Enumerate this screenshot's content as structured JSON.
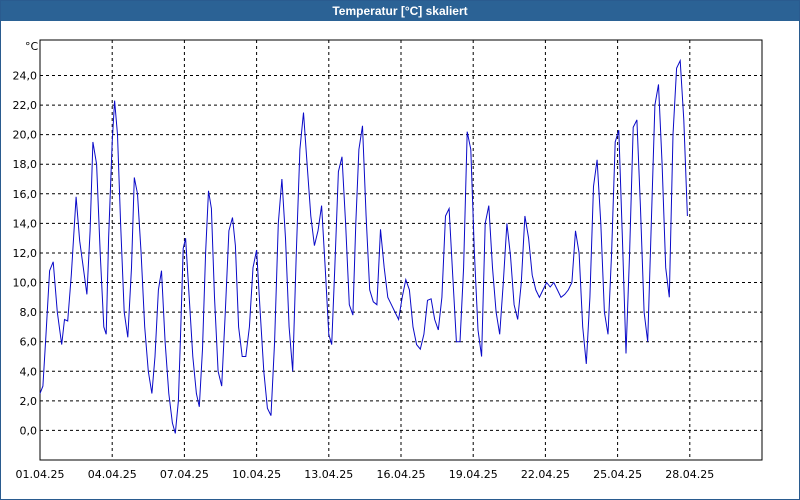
{
  "window": {
    "title": "Temperatur [°C] skaliert"
  },
  "colors": {
    "titlebar": "#2b6295",
    "series": "#0a0ac8",
    "grid": "#000000"
  },
  "chart_data": {
    "type": "line",
    "title": "Temperatur [°C] skaliert",
    "ylabel": "°C",
    "xlabel": "",
    "grid": true,
    "ylim": [
      -2.0,
      26.4
    ],
    "xlim": [
      "01.04.25",
      "31.04.25"
    ],
    "y_ticks": [
      "0,0",
      "2,0",
      "4,0",
      "6,0",
      "8,0",
      "10,0",
      "12,0",
      "14,0",
      "16,0",
      "18,0",
      "20,0",
      "22,0",
      "24,0"
    ],
    "x_ticks": [
      "01.04.25",
      "04.04.25",
      "07.04.25",
      "10.04.25",
      "13.04.25",
      "16.04.25",
      "19.04.25",
      "22.04.25",
      "25.04.25",
      "28.04.25"
    ],
    "x_tick_days": [
      1,
      4,
      7,
      10,
      13,
      16,
      19,
      22,
      25,
      28
    ],
    "series": [
      {
        "name": "",
        "x_days": [
          1.0,
          1.12,
          1.25,
          1.4,
          1.55,
          1.72,
          1.9,
          2.02,
          2.15,
          2.3,
          2.5,
          2.65,
          2.8,
          2.95,
          3.08,
          3.2,
          3.35,
          3.5,
          3.65,
          3.75,
          3.85,
          4.0,
          4.1,
          4.22,
          4.35,
          4.5,
          4.65,
          4.8,
          4.92,
          5.05,
          5.2,
          5.35,
          5.5,
          5.65,
          5.78,
          5.92,
          6.05,
          6.2,
          6.35,
          6.5,
          6.62,
          6.75,
          6.85,
          6.95,
          7.05,
          7.2,
          7.35,
          7.5,
          7.62,
          7.75,
          7.88,
          8.0,
          8.12,
          8.25,
          8.4,
          8.55,
          8.7,
          8.85,
          9.0,
          9.12,
          9.25,
          9.4,
          9.55,
          9.7,
          9.85,
          10.0,
          10.15,
          10.3,
          10.45,
          10.6,
          10.75,
          10.9,
          11.05,
          11.2,
          11.35,
          11.5,
          11.65,
          11.8,
          11.95,
          12.1,
          12.25,
          12.4,
          12.55,
          12.7,
          12.85,
          13.0,
          13.12,
          13.25,
          13.4,
          13.55,
          13.7,
          13.85,
          14.0,
          14.12,
          14.25,
          14.4,
          14.55,
          14.7,
          14.85,
          15.0,
          15.15,
          15.3,
          15.45,
          15.6,
          15.75,
          15.9,
          16.05,
          16.2,
          16.35,
          16.5,
          16.65,
          16.8,
          16.95,
          17.1,
          17.25,
          17.4,
          17.55,
          17.7,
          17.85,
          18.0,
          18.15,
          18.3,
          18.45,
          18.6,
          18.75,
          18.9,
          19.05,
          19.2,
          19.35,
          19.5,
          19.65,
          19.8,
          19.95,
          20.1,
          20.25,
          20.4,
          20.55,
          20.7,
          20.85,
          21.0,
          21.15,
          21.3,
          21.45,
          21.6,
          21.75,
          21.9,
          22.05,
          22.2,
          22.35,
          22.5,
          22.65,
          22.8,
          22.95,
          23.1,
          23.25,
          23.4,
          23.55,
          23.7,
          23.85,
          24.0,
          24.15,
          24.3,
          24.45,
          24.6,
          24.75,
          24.9,
          25.05,
          25.2,
          25.35,
          25.5,
          25.65,
          25.8,
          25.95,
          26.1,
          26.25,
          26.4,
          26.55,
          26.7,
          26.85,
          27.0,
          27.15,
          27.3,
          27.45,
          27.6,
          27.75,
          27.9,
          28.05,
          28.2,
          28.35,
          28.5,
          28.65,
          28.8,
          28.95,
          29.1,
          29.25,
          29.4,
          29.55,
          29.7,
          29.85,
          30.0,
          30.15,
          30.3,
          30.45,
          30.6,
          30.75,
          30.9
        ],
        "values": [
          2.5,
          3.0,
          6.5,
          10.8,
          11.4,
          8.0,
          5.8,
          7.5,
          7.4,
          10.5,
          15.8,
          12.8,
          11.0,
          9.2,
          13.5,
          19.5,
          18.0,
          12.0,
          7.0,
          6.5,
          13.0,
          19.5,
          22.3,
          20.0,
          14.0,
          8.0,
          6.3,
          11.0,
          17.1,
          16.0,
          12.0,
          7.0,
          4.0,
          2.5,
          5.0,
          9.5,
          10.8,
          6.0,
          2.5,
          0.5,
          -0.2,
          2.0,
          7.0,
          12.3,
          13.0,
          9.0,
          5.0,
          2.5,
          1.6,
          5.5,
          12.0,
          16.2,
          15.0,
          9.0,
          4.0,
          3.0,
          8.0,
          13.5,
          14.4,
          12.5,
          7.0,
          5.0,
          5.0,
          7.0,
          11.0,
          12.2,
          8.0,
          4.0,
          1.5,
          1.0,
          6.0,
          14.0,
          17.0,
          13.0,
          7.0,
          4.0,
          12.0,
          19.0,
          21.5,
          18.0,
          14.5,
          12.5,
          13.5,
          15.2,
          11.0,
          6.5,
          5.8,
          11.0,
          17.5,
          18.5,
          14.0,
          8.5,
          7.8,
          14.0,
          19.0,
          20.6,
          14.5,
          9.5,
          8.7,
          8.5,
          13.6,
          11.0,
          9.0,
          8.5,
          8.0,
          7.5,
          9.0,
          10.2,
          9.5,
          7.0,
          5.8,
          5.5,
          6.5,
          8.8,
          8.9,
          7.5,
          6.8,
          9.0,
          14.5,
          15.0,
          10.5,
          6.0,
          6.0,
          11.0,
          20.2,
          19.0,
          12.0,
          6.8,
          5.0,
          14.0,
          15.2,
          11.0,
          8.0,
          6.5,
          10.0,
          14.0,
          11.8,
          8.5,
          7.5,
          10.0,
          14.5,
          13.0,
          10.5,
          9.5,
          9.0,
          9.5,
          10.0,
          9.7,
          10.0,
          9.5,
          9.0,
          9.2,
          9.5,
          10.0,
          13.5,
          12.0,
          7.0,
          4.5,
          9.0,
          16.5,
          18.3,
          14.0,
          8.0,
          6.5,
          12.0,
          19.5,
          20.3,
          13.0,
          5.2,
          12.0,
          20.5,
          21.0,
          15.0,
          8.0,
          6.0,
          14.0,
          22.0,
          23.4,
          18.0,
          11.0,
          9.0,
          20.0,
          24.5,
          25.0,
          21.0,
          14.5
        ]
      }
    ]
  }
}
